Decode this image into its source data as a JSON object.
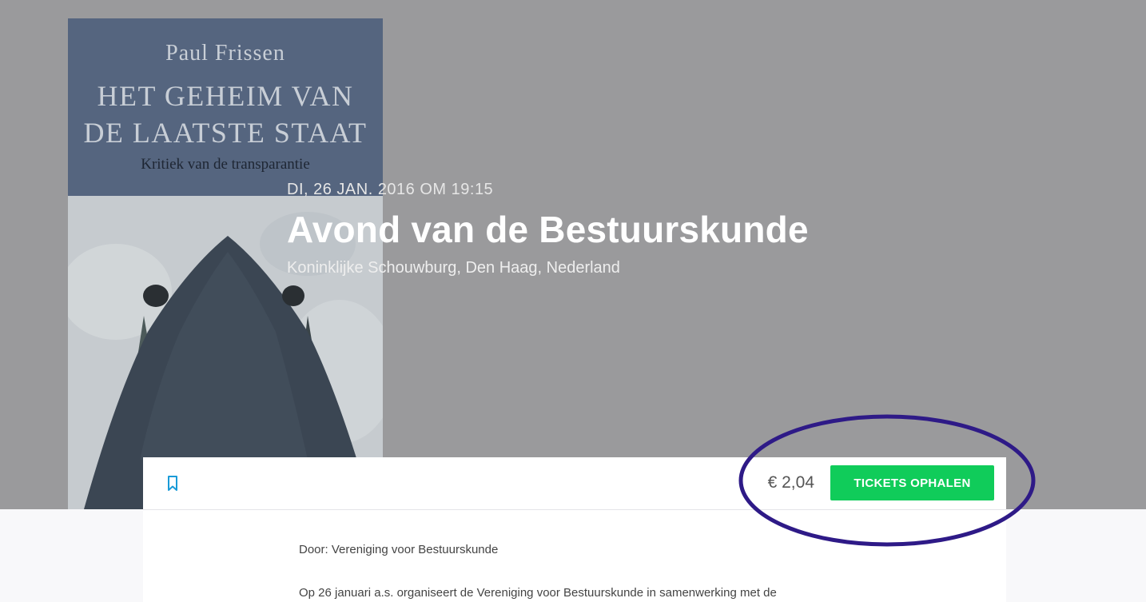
{
  "book_cover": {
    "author": "Paul Frissen",
    "title_line1": "HET GEHEIM VAN",
    "title_line2": "DE LAATSTE STAAT",
    "subtitle": "Kritiek van de transparantie"
  },
  "event": {
    "date": "DI, 26 JAN. 2016 OM 19:15",
    "title": "Avond van de Bestuurskunde",
    "location": "Koninklijke Schouwburg, Den Haag, Nederland"
  },
  "ticket_bar": {
    "bookmark_icon": "bookmark-icon",
    "price": "€ 2,04",
    "button_label": "TICKETS OPHALEN"
  },
  "details": {
    "organizer": "Door: Vereniging voor Bestuurskunde",
    "description_start": "Op 26 januari a.s. organiseert de Vereniging voor Bestuurskunde in samenwerking met de"
  },
  "colors": {
    "accent_green": "#10cc5a",
    "bookmark_blue": "#1a9bd8",
    "annotation_purple": "#2e1a87",
    "hero_gray": "#9a9a9c"
  }
}
